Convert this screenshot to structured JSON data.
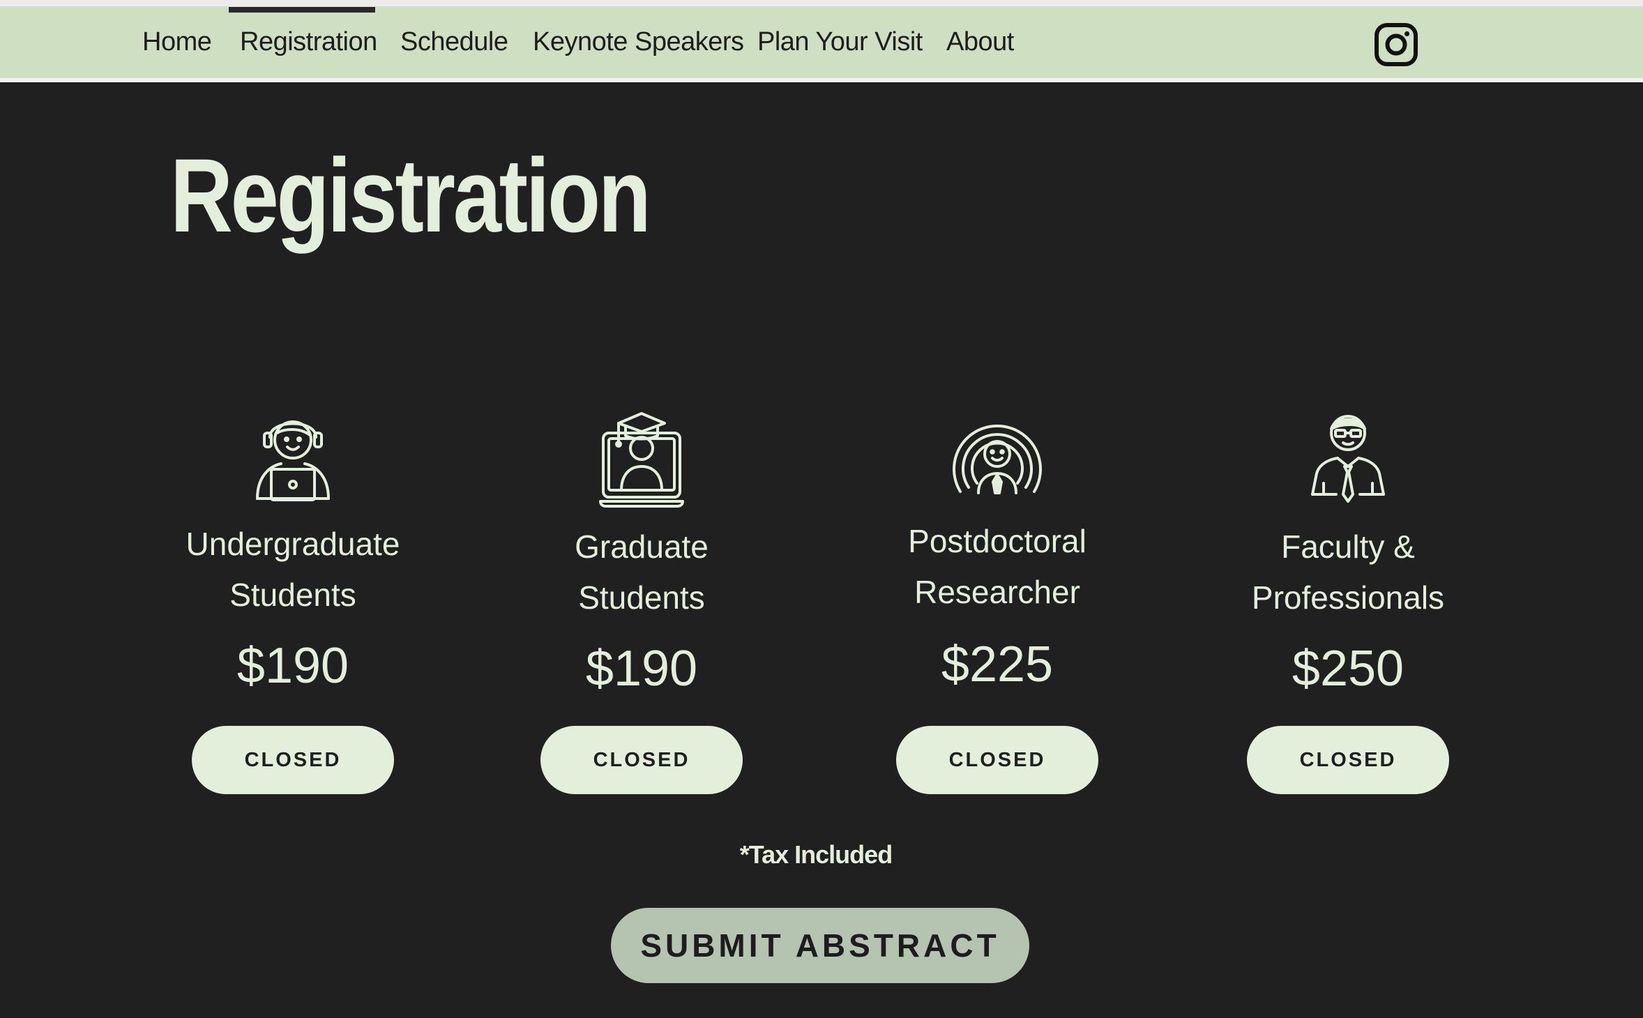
{
  "nav": {
    "items": [
      {
        "label": "Home"
      },
      {
        "label": "Registration",
        "active": true
      },
      {
        "label": "Schedule"
      },
      {
        "label": "Keynote Speakers"
      },
      {
        "label": "Plan Your Visit"
      },
      {
        "label": "About"
      }
    ],
    "social_icon": "instagram-icon"
  },
  "page_title": "Registration",
  "tiers": [
    {
      "label_line1": "Undergraduate",
      "label_line2": "Students",
      "price": "$190",
      "button": "CLOSED",
      "icon": "student-with-laptop-icon"
    },
    {
      "label_line1": "Graduate",
      "label_line2": "Students",
      "price": "$190",
      "button": "CLOSED",
      "icon": "graduate-cap-screen-icon"
    },
    {
      "label_line1": "Postdoctoral",
      "label_line2": "Researcher",
      "price": "$225",
      "button": "CLOSED",
      "icon": "researcher-radiating-icon"
    },
    {
      "label_line1": "Faculty &",
      "label_line2": "Professionals",
      "price": "$250",
      "button": "CLOSED",
      "icon": "professional-with-tie-icon"
    }
  ],
  "tax_note": "*Tax Included",
  "submit_button": "SUBMIT ABSTRACT",
  "colors": {
    "background": "#202020",
    "nav_background": "#cfdfc1",
    "text_light": "#e3efdb",
    "button_light": "#e3efdb",
    "submit_button": "#b5c4b0"
  }
}
